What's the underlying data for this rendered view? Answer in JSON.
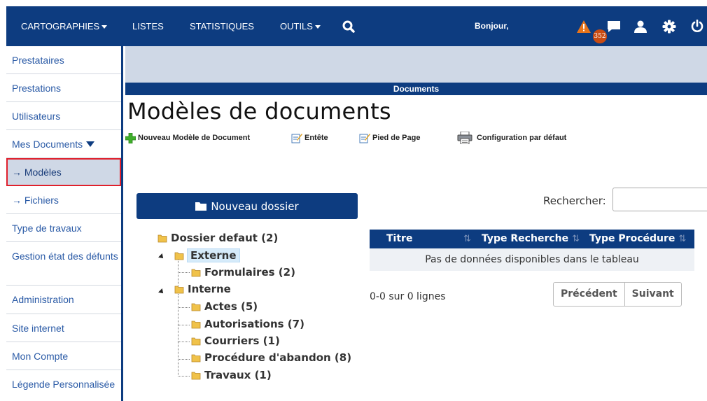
{
  "topbar": {
    "menu": [
      "CARTOGRAPHIES",
      "LISTES",
      "STATISTIQUES",
      "OUTILS"
    ],
    "greeting": "Bonjour,",
    "alert_count": "352",
    "icons": [
      "search-icon",
      "warning-icon",
      "chat-icon",
      "user-icon",
      "gear-icon",
      "power-icon"
    ]
  },
  "sidebar": {
    "items": [
      {
        "label": "Prestataires"
      },
      {
        "label": "Prestations"
      },
      {
        "label": "Utilisateurs"
      },
      {
        "label": "Mes Documents"
      },
      {
        "label": "→ Modèles"
      },
      {
        "label": "→ Fichiers"
      },
      {
        "label": "Type de travaux"
      },
      {
        "label": "Gestion état des défunts"
      },
      {
        "label": "Administration"
      },
      {
        "label": "Site internet"
      },
      {
        "label": "Mon Compte"
      },
      {
        "label": "Légende Personnalisée"
      }
    ]
  },
  "main": {
    "section_title": "Documents",
    "page_title": "Modèles de documents",
    "toolbar": {
      "new_model": "Nouveau Modèle de Document",
      "header": "Entête",
      "footer": "Pied de Page",
      "default_config": "Configuration par défaut"
    },
    "new_folder": "Nouveau dossier",
    "tree": {
      "root": "Dossier defaut (2)",
      "externe": "Externe",
      "formulaires": "Formulaires (2)",
      "interne": "Interne",
      "actes": "Actes (5)",
      "autorisations": "Autorisations (7)",
      "courriers": "Courriers (1)",
      "procedure": "Procédure d'abandon (8)",
      "travaux": "Travaux (1)"
    },
    "search_label": "Rechercher:",
    "search_value": "",
    "table": {
      "columns": [
        "Titre",
        "Type Recherche",
        "Type Procédure"
      ],
      "empty_message": "Pas de données disponibles dans le tableau"
    },
    "info": "0-0 sur 0 lignes",
    "pager": {
      "previous": "Précédent",
      "next": "Suivant"
    }
  },
  "colors": {
    "primary": "#0d3c80",
    "band": "#cfd8e6",
    "active_outline": "#e0202c",
    "badge": "#c94b12"
  }
}
